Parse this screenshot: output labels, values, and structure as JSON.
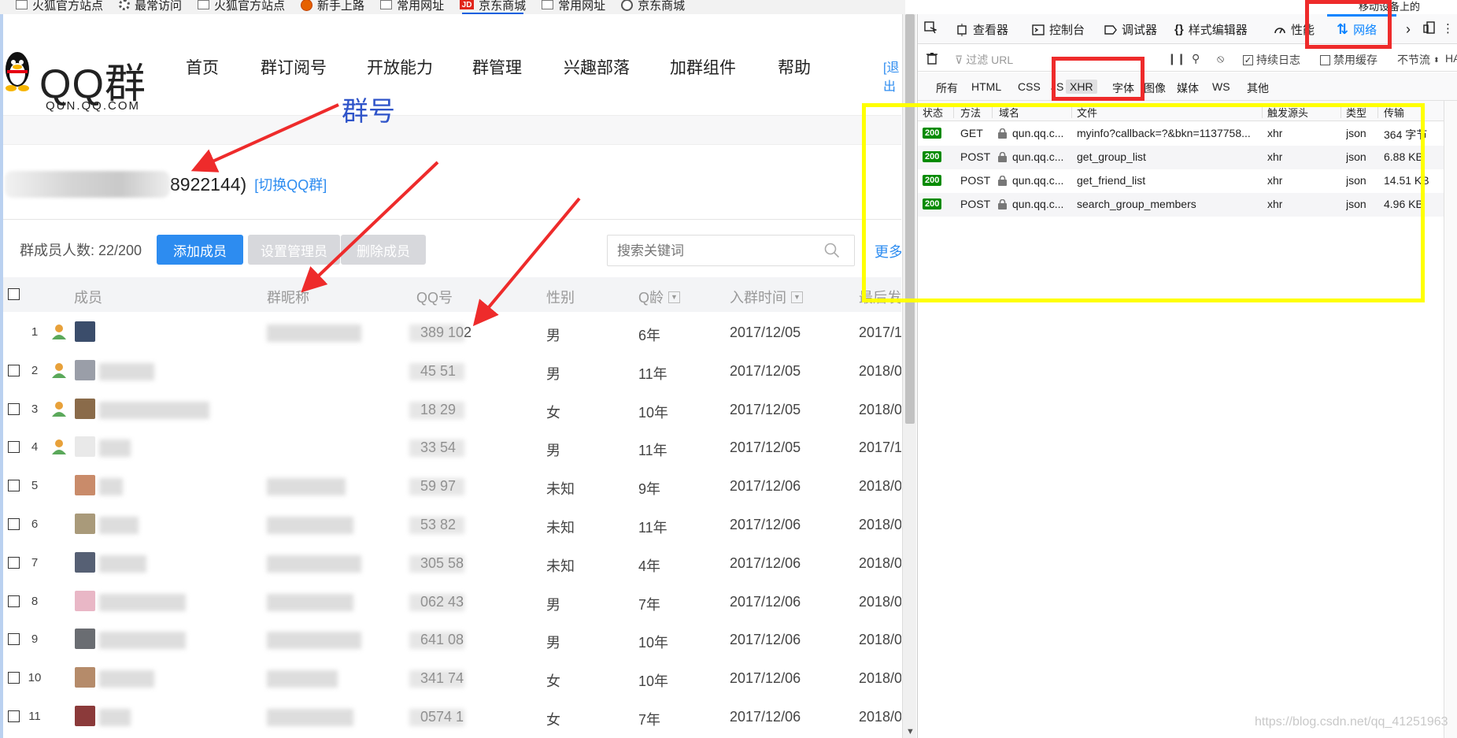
{
  "bookmarks": [
    {
      "label": "火狐官方站点",
      "icon": "folder-icon"
    },
    {
      "label": "最常访问",
      "icon": "gear-icon"
    },
    {
      "label": "火狐官方站点",
      "icon": "folder-icon"
    },
    {
      "label": "新手上路",
      "icon": "firefox-icon"
    },
    {
      "label": "常用网址",
      "icon": "folder-icon"
    },
    {
      "label": "京东商城",
      "icon": "jd-icon"
    },
    {
      "label": "常用网址",
      "icon": "folder-icon"
    },
    {
      "label": "京东商城",
      "icon": "globe-icon"
    }
  ],
  "site": {
    "logo_text": "QQ群",
    "logo_sub": "QUN.QQ.COM",
    "nav": [
      "首页",
      "群订阅号",
      "开放能力",
      "群管理",
      "兴趣部落",
      "加群组件",
      "帮助"
    ],
    "logout": "[退出"
  },
  "annotation": {
    "qunhao": "群号"
  },
  "group": {
    "id_tail": "8922144)",
    "switch": "[切换QQ群]"
  },
  "toolbar": {
    "member_count": "群成员人数: 22/200",
    "add": "添加成员",
    "set_admin": "设置管理员",
    "delete": "删除成员",
    "search_placeholder": "搜索关键词",
    "more": "更多"
  },
  "table": {
    "headers": [
      "成员",
      "群昵称",
      "QQ号",
      "性别",
      "Q龄",
      "入群时间",
      "最后发"
    ],
    "rows": [
      {
        "num": "1",
        "qq": "389  102",
        "gender": "男",
        "age": "6年",
        "join": "2017/12/05",
        "last": "2017/1"
      },
      {
        "num": "2",
        "qq": "45  51",
        "gender": "男",
        "age": "11年",
        "join": "2017/12/05",
        "last": "2018/0"
      },
      {
        "num": "3",
        "qq": "18  29",
        "gender": "女",
        "age": "10年",
        "join": "2017/12/05",
        "last": "2018/0"
      },
      {
        "num": "4",
        "qq": "33  54",
        "gender": "男",
        "age": "11年",
        "join": "2017/12/05",
        "last": "2017/1"
      },
      {
        "num": "5",
        "qq": "59  97",
        "gender": "未知",
        "age": "9年",
        "join": "2017/12/06",
        "last": "2018/0"
      },
      {
        "num": "6",
        "qq": "53  82",
        "gender": "未知",
        "age": "11年",
        "join": "2017/12/06",
        "last": "2018/0"
      },
      {
        "num": "7",
        "qq": "305  58",
        "gender": "未知",
        "age": "4年",
        "join": "2017/12/06",
        "last": "2018/0"
      },
      {
        "num": "8",
        "qq": "062  43",
        "gender": "男",
        "age": "7年",
        "join": "2017/12/06",
        "last": "2018/0"
      },
      {
        "num": "9",
        "qq": "641  08",
        "gender": "男",
        "age": "10年",
        "join": "2017/12/06",
        "last": "2018/0"
      },
      {
        "num": "10",
        "qq": "341  74",
        "gender": "女",
        "age": "10年",
        "join": "2017/12/06",
        "last": "2018/0"
      },
      {
        "num": "11",
        "qq": "0574  1",
        "gender": "女",
        "age": "7年",
        "join": "2017/12/06",
        "last": "2018/0"
      }
    ]
  },
  "devtools": {
    "tabs": [
      "查看器",
      "控制台",
      "调试器",
      "样式编辑器",
      "性能",
      "网络"
    ],
    "top_right": "移动设备上的",
    "filter_placeholder": "过滤 URL",
    "persist_log": "持续日志",
    "disable_cache": "禁用缓存",
    "throttle": "不节流",
    "har": "HA",
    "types": [
      "所有",
      "HTML",
      "CSS",
      "JS",
      "XHR",
      "字体",
      "图像",
      "媒体",
      "WS",
      "其他"
    ],
    "columns": [
      "状态",
      "方法",
      "域名",
      "文件",
      "触发源头",
      "类型",
      "传输"
    ],
    "requests": [
      {
        "status": "200",
        "method": "GET",
        "domain": "qun.qq.c...",
        "file": "myinfo?callback=?&bkn=1137758...",
        "cause": "xhr",
        "type": "json",
        "size": "364 字节"
      },
      {
        "status": "200",
        "method": "POST",
        "domain": "qun.qq.c...",
        "file": "get_group_list",
        "cause": "xhr",
        "type": "json",
        "size": "6.88 KB"
      },
      {
        "status": "200",
        "method": "POST",
        "domain": "qun.qq.c...",
        "file": "get_friend_list",
        "cause": "xhr",
        "type": "json",
        "size": "14.51 KB"
      },
      {
        "status": "200",
        "method": "POST",
        "domain": "qun.qq.c...",
        "file": "search_group_members",
        "cause": "xhr",
        "type": "json",
        "size": "4.96 KB"
      }
    ]
  },
  "watermark": "https://blog.csdn.net/qq_41251963",
  "colors": {
    "accent": "#2d8cf0",
    "annotation_red": "#ee2b2b",
    "annotation_yellow": "#ffff00",
    "status_ok": "#058b00"
  }
}
